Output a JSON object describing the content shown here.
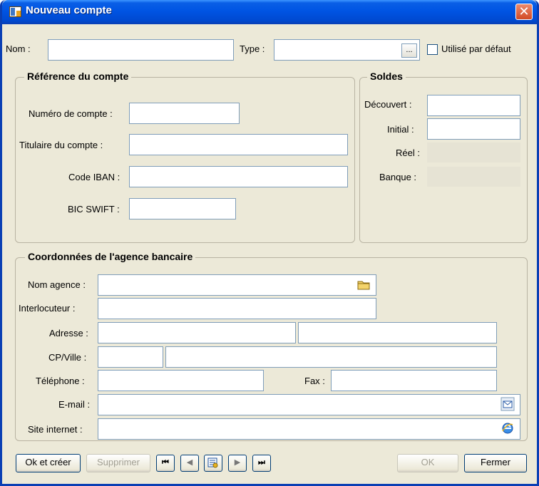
{
  "window": {
    "title": "Nouveau compte",
    "close_symbol": "✕"
  },
  "top_row": {
    "nom_label": "Nom :",
    "nom_value": "",
    "type_label": "Type :",
    "type_value": "",
    "type_browse": "...",
    "default_checkbox_label": "Utilisé par défaut",
    "default_checked": false
  },
  "reference": {
    "title": "Référence du compte",
    "numero_label": "Numéro de compte :",
    "numero_value": "",
    "titulaire_label": "Titulaire du compte :",
    "titulaire_value": "",
    "iban_label": "Code IBAN :",
    "iban_value": "",
    "bic_label": "BIC SWIFT :",
    "bic_value": ""
  },
  "soldes": {
    "title": "Soldes",
    "decouvert_label": "Découvert :",
    "decouvert_value": "",
    "initial_label": "Initial :",
    "initial_value": "",
    "reel_label": "Réel :",
    "reel_value": "",
    "banque_label": "Banque :",
    "banque_value": ""
  },
  "agence": {
    "title": "Coordonnées de l'agence bancaire",
    "nom_agence_label": "Nom agence :",
    "nom_agence_value": "",
    "interlocuteur_label": "Interlocuteur :",
    "interlocuteur_value": "",
    "adresse_label": "Adresse :",
    "adresse1_value": "",
    "adresse2_value": "",
    "cp_ville_label": "CP/Ville :",
    "cp_value": "",
    "ville_value": "",
    "telephone_label": "Téléphone :",
    "telephone_value": "",
    "fax_label": "Fax :",
    "fax_value": "",
    "email_label": "E-mail :",
    "email_value": "",
    "site_label": "Site internet :",
    "site_value": ""
  },
  "footer": {
    "ok_creer": "Ok et créer",
    "supprimer": "Supprimer",
    "nav_first": "⏮",
    "nav_prev": "◀",
    "nav_next": "▶",
    "nav_last": "⏭",
    "ok": "OK",
    "fermer": "Fermer"
  },
  "icons": {
    "folder": "folder-icon",
    "email": "email-icon",
    "internet": "internet-explorer-icon",
    "search": "search-record-icon"
  }
}
